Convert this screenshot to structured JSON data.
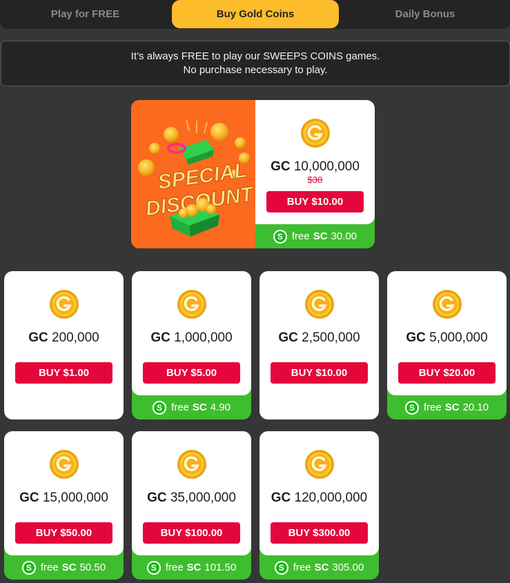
{
  "tabs": [
    {
      "label": "Play for FREE"
    },
    {
      "label": "Buy Gold Coins"
    },
    {
      "label": "Daily Bonus"
    }
  ],
  "info": {
    "line1": "It’s always FREE to play our SWEEPS COINS games.",
    "line2": "No purchase necessary to play."
  },
  "featured": {
    "promo_line1": "SPECIAL",
    "promo_line2": "DISCOUNT",
    "gc_label": "GC",
    "gc_amount": "10,000,000",
    "old_price": "$30",
    "buy_label": "BUY $10.00",
    "free_label": "free",
    "sc_label": "SC",
    "sc_amount": "30.00"
  },
  "packages": [
    {
      "gc_label": "GC",
      "gc_amount": "200,000",
      "buy_label": "BUY $1.00",
      "has_sc": false
    },
    {
      "gc_label": "GC",
      "gc_amount": "1,000,000",
      "buy_label": "BUY $5.00",
      "has_sc": true,
      "free_label": "free",
      "sc_label": "SC",
      "sc_amount": "4.90"
    },
    {
      "gc_label": "GC",
      "gc_amount": "2,500,000",
      "buy_label": "BUY $10.00",
      "has_sc": false
    },
    {
      "gc_label": "GC",
      "gc_amount": "5,000,000",
      "buy_label": "BUY $20.00",
      "has_sc": true,
      "free_label": "free",
      "sc_label": "SC",
      "sc_amount": "20.10"
    },
    {
      "gc_label": "GC",
      "gc_amount": "15,000,000",
      "buy_label": "BUY $50.00",
      "has_sc": true,
      "free_label": "free",
      "sc_label": "SC",
      "sc_amount": "50.50"
    },
    {
      "gc_label": "GC",
      "gc_amount": "35,000,000",
      "buy_label": "BUY $100.00",
      "has_sc": true,
      "free_label": "free",
      "sc_label": "SC",
      "sc_amount": "101.50"
    },
    {
      "gc_label": "GC",
      "gc_amount": "120,000,000",
      "buy_label": "BUY $300.00",
      "has_sc": true,
      "free_label": "free",
      "sc_label": "SC",
      "sc_amount": "305.00"
    }
  ],
  "icons": {
    "gold_coin": "gold-coin-icon",
    "sweeps_coin": "sweeps-coin-icon",
    "sweeps_coin_letter": "S"
  },
  "colors": {
    "accent_gold": "#fdbd2a",
    "buy_red": "#e4073b",
    "sc_green": "#3fbd30",
    "promo_orange": "#fb6a1f"
  }
}
